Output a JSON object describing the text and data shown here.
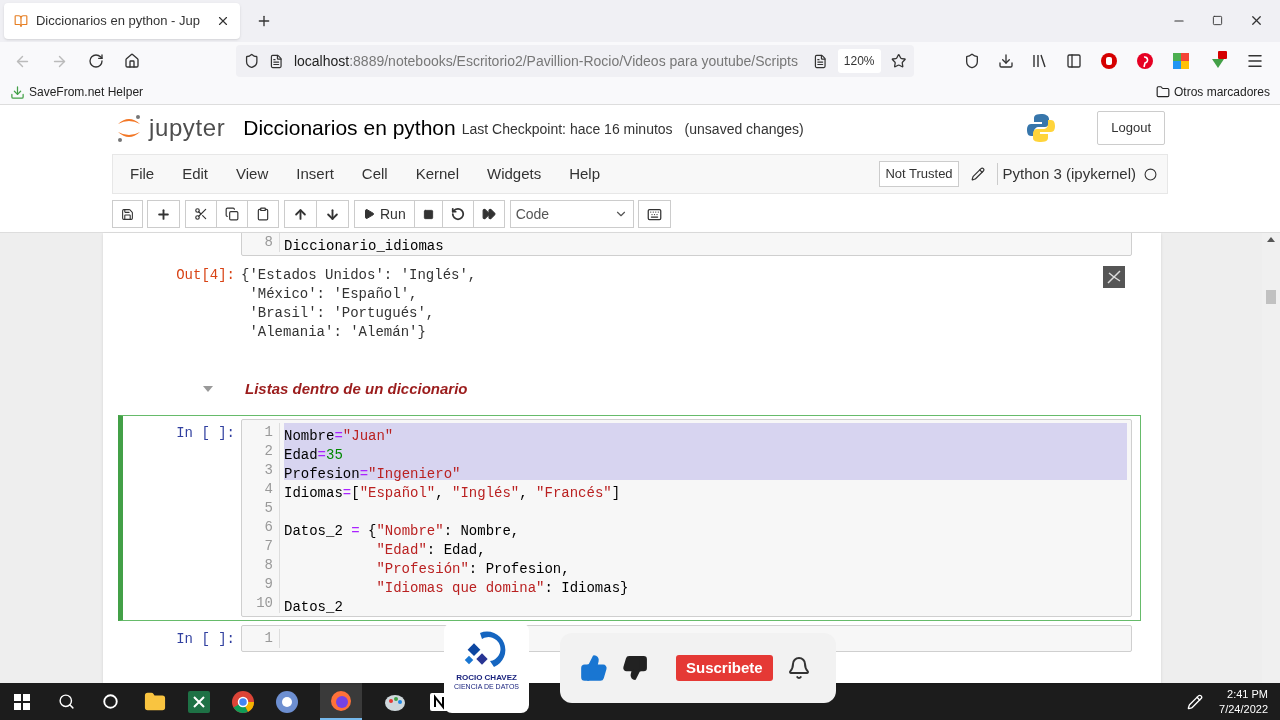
{
  "browser": {
    "tab_title": "Diccionarios en python - Jup",
    "url_host": "localhost",
    "url_path": ":8889/notebooks/Escritorio2/Pavillion-Rocio/Videos para youtube/Scripts",
    "zoom": "120%",
    "bookmarks": [
      "SaveFrom.net Helper"
    ],
    "other_bookmarks": "Otros marcadores"
  },
  "jupyter": {
    "logo": "jupyter",
    "notebook_name": "Diccionarios en python",
    "checkpoint": "Last Checkpoint: hace 16 minutos",
    "save_status": "(unsaved changes)",
    "logout": "Logout",
    "menu": [
      "File",
      "Edit",
      "View",
      "Insert",
      "Cell",
      "Kernel",
      "Widgets",
      "Help"
    ],
    "trusted": "Not Trusted",
    "kernel": "Python 3 (ipykernel)",
    "run": "Run",
    "cell_type": "Code"
  },
  "cells": [
    {
      "kind": "code",
      "selected": false,
      "lines": [
        {
          "number": "8",
          "selected": false,
          "tokens": [
            {
              "text": "Diccionario_idiomas",
              "kind": "plain"
            }
          ]
        }
      ]
    },
    {
      "kind": "output",
      "prompt": "Out[4]:",
      "lines": [
        "{'Estados Unidos': 'Inglés',",
        " 'México': 'Español',",
        " 'Brasil': 'Portugués',",
        " 'Alemania': 'Alemán'}"
      ]
    },
    {
      "kind": "heading",
      "text": "Listas dentro de un diccionario"
    },
    {
      "kind": "code",
      "prompt": "In [ ]:",
      "selected": true,
      "lines": [
        {
          "number": "1",
          "selected": true,
          "tokens": [
            {
              "text": "Nombre",
              "kind": "plain"
            },
            {
              "text": "=",
              "kind": "op"
            },
            {
              "text": "\"Juan\"",
              "kind": "str"
            }
          ]
        },
        {
          "number": "2",
          "selected": true,
          "tokens": [
            {
              "text": "Edad",
              "kind": "plain"
            },
            {
              "text": "=",
              "kind": "op"
            },
            {
              "text": "35",
              "kind": "num"
            }
          ]
        },
        {
          "number": "3",
          "selected": true,
          "tokens": [
            {
              "text": "Profesion",
              "kind": "plain"
            },
            {
              "text": "=",
              "kind": "op"
            },
            {
              "text": "\"Ingeniero\"",
              "kind": "str"
            }
          ]
        },
        {
          "number": "4",
          "selected": false,
          "tokens": [
            {
              "text": "Idiomas",
              "kind": "plain"
            },
            {
              "text": "=",
              "kind": "op"
            },
            {
              "text": "[",
              "kind": "plain"
            },
            {
              "text": "\"Español\"",
              "kind": "str"
            },
            {
              "text": ", ",
              "kind": "plain"
            },
            {
              "text": "\"Inglés\"",
              "kind": "str"
            },
            {
              "text": ", ",
              "kind": "plain"
            },
            {
              "text": "\"Francés\"",
              "kind": "str"
            },
            {
              "text": "]",
              "kind": "plain"
            }
          ]
        },
        {
          "number": "5",
          "selected": false
        },
        {
          "number": "6",
          "selected": false,
          "tokens": [
            {
              "text": "Datos_2 ",
              "kind": "plain"
            },
            {
              "text": "=",
              "kind": "op"
            },
            {
              "text": " {",
              "kind": "plain"
            },
            {
              "text": "\"Nombre\"",
              "kind": "str"
            },
            {
              "text": ": Nombre,",
              "kind": "plain"
            }
          ]
        },
        {
          "number": "7",
          "selected": false,
          "tokens": [
            {
              "text": "           \"Edad\"",
              "kind": "str"
            },
            {
              "text": ": Edad,",
              "kind": "plain"
            }
          ]
        },
        {
          "number": "8",
          "selected": false,
          "tokens": [
            {
              "text": "           \"Profesión\"",
              "kind": "str"
            },
            {
              "text": ": Profesion,",
              "kind": "plain"
            }
          ]
        },
        {
          "number": "9",
          "selected": false,
          "tokens": [
            {
              "text": "           \"Idiomas que domina\"",
              "kind": "str"
            },
            {
              "text": ": Idiomas}",
              "kind": "plain"
            }
          ]
        },
        {
          "number": "10",
          "selected": false,
          "tokens": [
            {
              "text": "Datos_2",
              "kind": "plain"
            }
          ]
        }
      ]
    },
    {
      "kind": "code",
      "prompt": "In [ ]:",
      "selected": false,
      "lines": [
        {
          "number": "1",
          "selected": false
        }
      ]
    }
  ],
  "overlay": {
    "brand_name": "ROCIO CHAVEZ",
    "brand_tagline": "CIENCIA DE DATOS",
    "subscribe": "Suscribete"
  },
  "taskbar": {
    "time": "2:41 PM",
    "date": "7/24/2022"
  }
}
